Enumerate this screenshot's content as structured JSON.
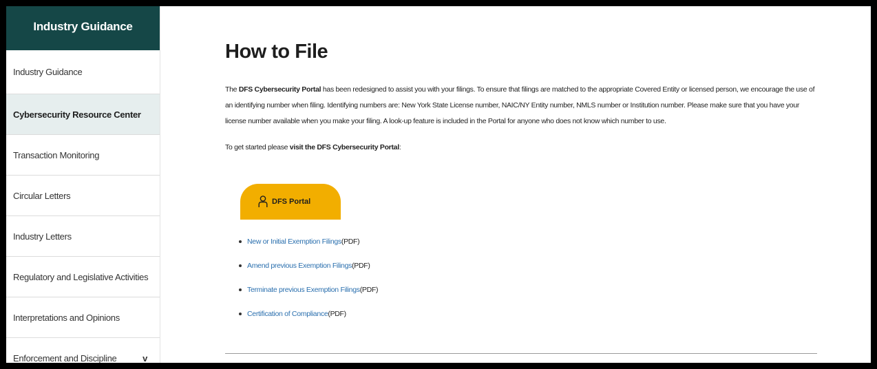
{
  "sidebar": {
    "header": "Industry Guidance",
    "items": [
      {
        "label": "Industry Guidance"
      },
      {
        "label": "Cybersecurity Resource Center"
      },
      {
        "label": "Transaction Monitoring"
      },
      {
        "label": "Circular Letters"
      },
      {
        "label": "Industry Letters"
      },
      {
        "label": "Regulatory and Legislative Activities"
      },
      {
        "label": "Interpretations and Opinions"
      },
      {
        "label": "Enforcement and Discipline"
      }
    ],
    "chevron": "v",
    "active_index": 1
  },
  "main": {
    "title": "How to File",
    "intro": {
      "lead": "The ",
      "portal_name": "DFS Cybersecurity Portal",
      "body": " has been redesigned to assist you with your filings. To ensure that filings are matched to the appropriate Covered Entity or licensed person, we encourage the use of an identifying number when filing. Identifying numbers are: New York State License number, NAIC/NY Entity number, NMLS number or Institution number. Please make sure that you have your license number available when you make your filing. A look-up feature is included in the Portal for anyone who does not know which number to use."
    },
    "getstarted": {
      "lead": "To get started please ",
      "link": "visit the DFS Cybersecurity Portal",
      "tail": ":"
    },
    "portal_button": {
      "label": "DFS Portal",
      "icon": "user-icon",
      "color": "#f2ae00"
    },
    "links": [
      {
        "text": "New or Initial Exemption Filings",
        "suffix": " (PDF)"
      },
      {
        "text": "Amend previous Exemption Filings",
        "suffix": " (PDF)"
      },
      {
        "text": "Terminate previous Exemption Filings",
        "suffix": " (PDF)"
      },
      {
        "text": "Certification of Compliance",
        "suffix": " (PDF)"
      }
    ]
  },
  "colors": {
    "sidebar_header": "#154747",
    "active_item": "#e6eeee",
    "link": "#2a6fae",
    "button": "#f2ae00"
  }
}
